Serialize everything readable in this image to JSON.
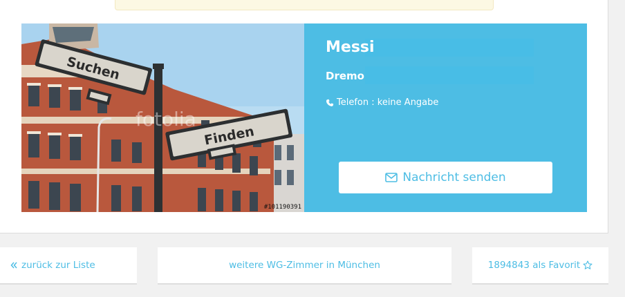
{
  "contact": {
    "name": "Messi",
    "company": "Dremo",
    "phone_label": "Telefon : keine Angabe",
    "message_button": "Nachricht senden"
  },
  "photo": {
    "sign_top": "Suchen",
    "sign_bottom": "Finden",
    "watermark": "fotolia",
    "image_id": "#101190391"
  },
  "nav": {
    "back_label": "zurück zur Liste",
    "more_label": "weitere WG-Zimmer in München",
    "favorite_label": "1894843 als Favorit"
  },
  "icons": {
    "back": "double-chevron-left-icon",
    "phone": "phone-icon",
    "message": "envelope-icon",
    "favorite": "star-outline-icon"
  },
  "colors": {
    "accent": "#4dbde4",
    "page_bg": "#f1f1f1",
    "notice_bg": "#fcf8e3"
  }
}
